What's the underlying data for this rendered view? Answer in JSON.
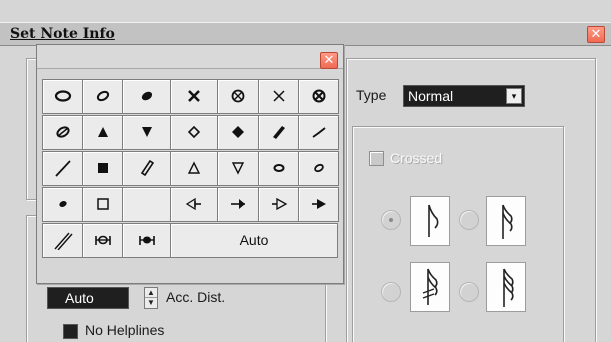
{
  "dialog": {
    "title": "Set Note Info",
    "close_glyph": "✕"
  },
  "type": {
    "label": "Type",
    "value": "Normal",
    "arrow_glyph": "▾"
  },
  "crossed": {
    "label": "Crossed",
    "checked": false
  },
  "stem_options": [
    {
      "name": "single-flag",
      "selected": true
    },
    {
      "name": "double-flag",
      "selected": false
    },
    {
      "name": "double-slash",
      "selected": false
    },
    {
      "name": "triple-slash",
      "selected": false
    }
  ],
  "acc_dist": {
    "value": "Auto",
    "label": "Acc. Dist.",
    "up_glyph": "▲",
    "down_glyph": "▼"
  },
  "helplines": {
    "label": "No Helplines",
    "checked": true
  },
  "palette": {
    "close_glyph": "✕",
    "rows": [
      [
        "oval-outline",
        "slanted-oval-outline",
        "filled-oval",
        "x-bold",
        "circle-x",
        "x-thin",
        "circle-x-bold"
      ],
      [
        "slash-oval",
        "triangle-up-filled",
        "triangle-down-filled",
        "diamond-outline",
        "diamond-filled",
        "slash-thick",
        "slash-thin"
      ],
      [
        "slash-long",
        "square-filled",
        "slash-parallelogram",
        "triangle-up-outline",
        "triangle-down-outline",
        "small-oval-outline",
        "small-slanted-oval"
      ],
      [
        "small-dot",
        "square-outline",
        "empty",
        "left-arrow-tri",
        "left-arrow-filled",
        "right-tri-outline",
        "right-tri-filled"
      ],
      [
        "double-slash-long",
        "tremolo-1",
        "tremolo-2",
        "auto-button"
      ]
    ],
    "auto_label": "Auto"
  },
  "colors": {
    "close_button": "#f06a52",
    "field_background": "#1f1f1f",
    "dialog_background": "#d6d6d6"
  }
}
